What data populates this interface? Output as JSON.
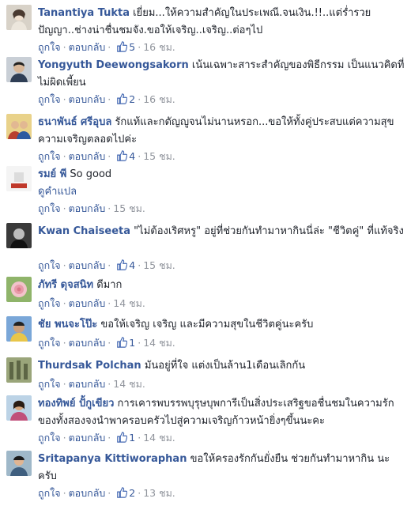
{
  "labels": {
    "like": "ถูกใจ",
    "reply": "ตอบกลับ",
    "translate": "ดูคำแปล",
    "dot": "·"
  },
  "comments": [
    {
      "author": "Tanantiya Tukta",
      "text": "เยี่ยม...ให้ความสำคัญในประเพณี.จนเงิน.!!..แต่ร่ำรวยปัญญา..ช่างน่าชื่นชมจัง.ขอให้เจริญ..เจริญ..ต่อๆไป",
      "likes": "5",
      "time": "16 ชม."
    },
    {
      "author": "Yongyuth Deewongsakorn",
      "text": "เน้นเฉพาะสาระสำคัญของพิธีกรรม เป็นแนวคิดที่ไม่ผิดเพี้ยน",
      "likes": "2",
      "time": "16 ชม."
    },
    {
      "author": "ธนาพันธ์ ศรีอุบล",
      "text": "รักแท้และกตัญญูจนไม่นานหรอก...ขอให้ทั้งคู่ประสบแต่ความสุขความเจริญตลอดไปค่ะ",
      "likes": "4",
      "time": "15 ชม."
    },
    {
      "author": "รมย์ พี",
      "text": "So good",
      "likes": "",
      "time": "15 ชม."
    },
    {
      "author": "Kwan Chaiseeta",
      "text": "\"ไม่ต้องเริศหรู\" อยู่ที่ช่วยกันทำมาหากินนี่ล่ะ \"ชีวิตคู่\" ที่แท้จริง",
      "likes": "4",
      "time": "15 ชม."
    },
    {
      "author": "ภัทรี ดุจสนิท",
      "text": "ดีมาก",
      "likes": "",
      "time": "14 ชม."
    },
    {
      "author": "ชัย พนจะโป๊ะ",
      "text": "ขอให้เจริญ เจริญ และมีความสุขในชีวิตคู่นะครับ",
      "likes": "1",
      "time": "14 ชม."
    },
    {
      "author": "Thurdsak Polchan",
      "text": "มันอยู่ที่ใจ แต่งเป็นล้าน1เดือนเลิกกัน",
      "likes": "",
      "time": "14 ชม."
    },
    {
      "author": "ทองทิพย์ ปั้กูเขียว",
      "text": "การเคารพบรรพบุรุษบุพการีเป็นสิ่งประเสริฐขอชื่นชมในความรักของทั้งสองจงนำพาครอบครัวไปสู่ความเจริญก้าวหน้ายิ่งๆขึ้นนะคะ",
      "likes": "1",
      "time": "14 ชม."
    },
    {
      "author": "Sritapanya Kittiworaphan",
      "text": "ขอให้ครองรักกันยั่งยืน ช่วยกันทำมาหากิน นะครับ",
      "likes": "2",
      "time": "13 ชม."
    }
  ],
  "colors": {
    "link": "#365899",
    "muted": "#90949c",
    "text": "#1d2129",
    "like_blue": "#4267b2"
  },
  "icons": {
    "like": "thumbs-up-icon"
  }
}
